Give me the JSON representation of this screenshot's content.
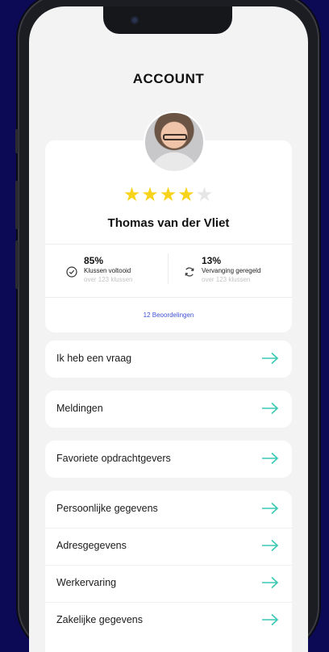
{
  "header": {
    "title": "ACCOUNT"
  },
  "profile": {
    "name": "Thomas van der Vliet",
    "rating": 4,
    "rating_max": 5,
    "stats": [
      {
        "value": "85%",
        "label": "Klussen voltooid",
        "sub": "over 123 klussen",
        "icon": "check-circle-icon"
      },
      {
        "value": "13%",
        "label": "Vervanging geregeld",
        "sub": "over 123 klussen",
        "icon": "refresh-icon"
      }
    ],
    "reviews_link": "12 Beoordelingen"
  },
  "menu": {
    "question": "Ik heb een vraag",
    "notifications": "Meldingen",
    "favorites": "Favoriete opdrachtgevers",
    "personal": "Persoonlijke gegevens",
    "address": "Adresgegevens",
    "experience": "Werkervaring",
    "business": "Zakelijke gegevens"
  },
  "colors": {
    "accent": "#3ac8b5",
    "background": "#0c0a55",
    "star": "#f7d31b",
    "link": "#3f52d6"
  }
}
